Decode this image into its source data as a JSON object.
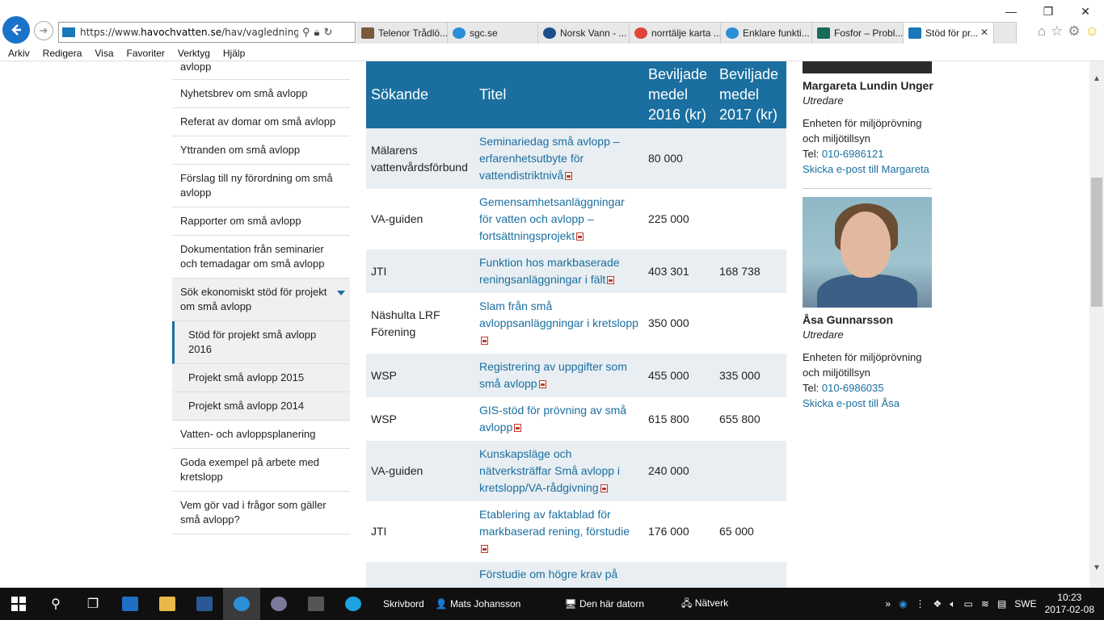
{
  "browser": {
    "url_prefix": "https://www.",
    "url_domain": "havochvatten.se",
    "url_rest": "/hav/vagledning--lag",
    "tabs": [
      {
        "label": "Telenor Trådlö...",
        "color": "#7a5a3a"
      },
      {
        "label": "sgc.se",
        "color": "#2a8fd6"
      },
      {
        "label": "Norsk Vann - ...",
        "color": "#1a4f8a"
      },
      {
        "label": "norrtälje karta ...",
        "color": "#e0453a"
      },
      {
        "label": "Enklare funkti...",
        "color": "#2a8fd6"
      },
      {
        "label": "Fosfor – Probl...",
        "color": "#1a6a5a"
      },
      {
        "label": "Stöd för pr...",
        "color": "#1a78b8"
      }
    ],
    "menu": [
      "Arkiv",
      "Redigera",
      "Visa",
      "Favoriter",
      "Verktyg",
      "Hjälp"
    ]
  },
  "leftnav": {
    "items": [
      {
        "label": "avlopp"
      },
      {
        "label": "Nyhetsbrev om små avlopp"
      },
      {
        "label": "Referat av domar om små avlopp"
      },
      {
        "label": "Yttranden om små avlopp"
      },
      {
        "label": "Förslag till ny förordning om små avlopp"
      },
      {
        "label": "Rapporter om små avlopp"
      },
      {
        "label": "Dokumentation från seminarier och temadagar om små avlopp"
      },
      {
        "label": "Sök ekonomiskt stöd för projekt om små avlopp"
      },
      {
        "label": "Stöd för projekt små avlopp 2016"
      },
      {
        "label": "Projekt små avlopp 2015"
      },
      {
        "label": "Projekt små avlopp 2014"
      },
      {
        "label": "Vatten- och avloppsplanering"
      },
      {
        "label": "Goda exempel på arbete med kretslopp"
      },
      {
        "label": "Vem gör vad i frågor som gäller små avlopp?"
      }
    ]
  },
  "table": {
    "headers": [
      "Sökande",
      "Titel",
      "Beviljade medel 2016 (kr)",
      "Beviljade medel 2017 (kr)"
    ],
    "rows": [
      {
        "applicant": "Mälarens vattenvårdsförbund",
        "title": "Seminariedag små avlopp – erfarenhetsutbyte för vattendistriktnivå",
        "y2016": "80 000",
        "y2017": ""
      },
      {
        "applicant": "VA-guiden",
        "title": "Gemensamhetsanläggningar för vatten och avlopp – fortsättningsprojekt",
        "y2016": "225 000",
        "y2017": ""
      },
      {
        "applicant": "JTI",
        "title": "Funktion hos markbaserade reningsanläggningar i fält",
        "y2016": "403 301",
        "y2017": "168 738"
      },
      {
        "applicant": "Näshulta LRF Förening",
        "title": "Slam från små avloppsanläggningar i kretslopp",
        "y2016": "350 000",
        "y2017": ""
      },
      {
        "applicant": "WSP",
        "title": "Registrering av uppgifter som små avlopp",
        "y2016": "455 000",
        "y2017": "335 000"
      },
      {
        "applicant": "WSP",
        "title": "GIS-stöd för prövning av små avlopp",
        "y2016": "615 800",
        "y2017": "655 800"
      },
      {
        "applicant": "VA-guiden",
        "title": "Kunskapsläge och nätverksträffar Små avlopp i kretslopp/VA-rådgivning",
        "y2016": "240 000",
        "y2017": ""
      },
      {
        "applicant": "JTI",
        "title": "Etablering av faktablad för markbaserad rening, förstudie",
        "y2016": "176 000",
        "y2017": "65 000"
      },
      {
        "applicant": "",
        "title": "Förstudie om högre krav på",
        "y2016": "",
        "y2017": ""
      }
    ]
  },
  "contacts": [
    {
      "name": "Margareta Lundin Unger",
      "role": "Utredare",
      "unit": "Enheten för miljöprövning och miljötillsyn",
      "tel_label": "Tel:",
      "tel": "010-6986121",
      "email": "Skicka e-post till Margareta"
    },
    {
      "name": "Åsa Gunnarsson",
      "role": "Utredare",
      "unit": "Enheten för miljöprövning och miljötillsyn",
      "tel_label": "Tel:",
      "tel": "010-6986035",
      "email": "Skicka e-post till Åsa"
    }
  ],
  "taskbar": {
    "desktop_label": "Skrivbord",
    "user_label": "Mats Johansson",
    "computer_label": "Den här datorn",
    "network_label": "Nätverk",
    "lang": "SWE",
    "time": "10:23",
    "date": "2017-02-08"
  }
}
